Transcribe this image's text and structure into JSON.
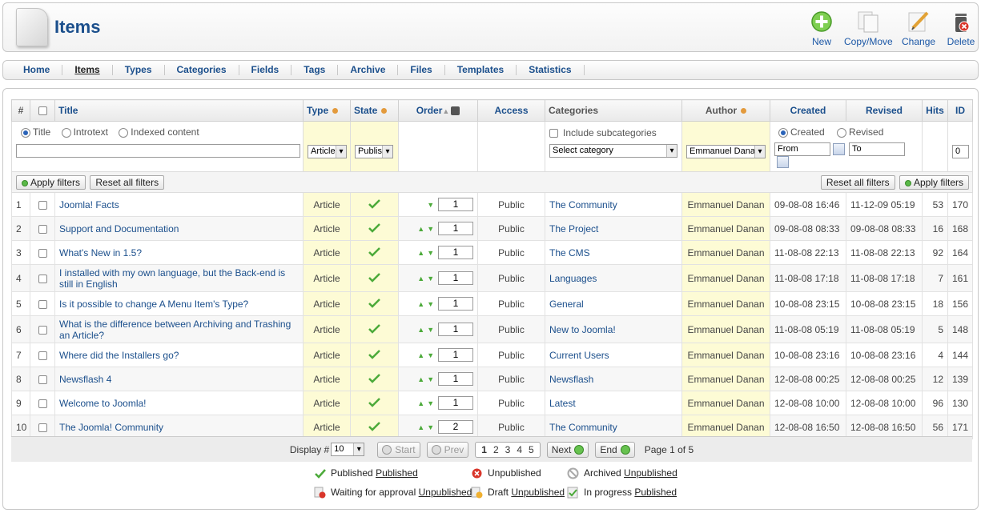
{
  "header": {
    "title": "Items"
  },
  "toolbar": [
    {
      "label": "New",
      "icon": "new-icon"
    },
    {
      "label": "Copy/Move",
      "icon": "copy-move-icon"
    },
    {
      "label": "Change",
      "icon": "change-icon"
    },
    {
      "label": "Delete",
      "icon": "delete-icon"
    }
  ],
  "menu": [
    "Home",
    "Items",
    "Types",
    "Categories",
    "Fields",
    "Tags",
    "Archive",
    "Files",
    "Templates",
    "Statistics"
  ],
  "menu_active": "Items",
  "columns": {
    "num": "#",
    "title": "Title",
    "type": "Type",
    "state": "State",
    "order": "Order",
    "access": "Access",
    "categories": "Categories",
    "author": "Author",
    "created": "Created",
    "revised": "Revised",
    "hits": "Hits",
    "id": "ID"
  },
  "filters": {
    "search_options": [
      "Title",
      "Introtext",
      "Indexed content"
    ],
    "search_selected": "Title",
    "search_value": "",
    "type_value": "Article",
    "state_value": "Publis",
    "include_subcategories": "Include subcategories",
    "category_value": "Select category",
    "author_value": "Emmanuel Dana",
    "date_options": [
      "Created",
      "Revised"
    ],
    "date_selected": "Created",
    "from_value": "From",
    "to_value": "To",
    "id_value": "0",
    "apply_label": "Apply filters",
    "reset_label": "Reset all filters"
  },
  "rows": [
    {
      "num": "1",
      "title": "Joomla! Facts",
      "type": "Article",
      "order": "1",
      "up": false,
      "access": "Public",
      "category": "The Community",
      "author": "Emmanuel Danan",
      "created": "09-08-08 16:46",
      "revised": "11-12-09 05:19",
      "hits": "53",
      "id": "170"
    },
    {
      "num": "2",
      "title": "Support and Documentation",
      "type": "Article",
      "order": "1",
      "up": true,
      "access": "Public",
      "category": "The Project",
      "author": "Emmanuel Danan",
      "created": "09-08-08 08:33",
      "revised": "09-08-08 08:33",
      "hits": "16",
      "id": "168"
    },
    {
      "num": "3",
      "title": "What's New in 1.5?",
      "type": "Article",
      "order": "1",
      "up": true,
      "access": "Public",
      "category": "The CMS",
      "author": "Emmanuel Danan",
      "created": "11-08-08 22:13",
      "revised": "11-08-08 22:13",
      "hits": "92",
      "id": "164"
    },
    {
      "num": "4",
      "title": "I installed with my own language, but the Back-end is still in English",
      "type": "Article",
      "order": "1",
      "up": true,
      "access": "Public",
      "category": "Languages",
      "author": "Emmanuel Danan",
      "created": "11-08-08 17:18",
      "revised": "11-08-08 17:18",
      "hits": "7",
      "id": "161"
    },
    {
      "num": "5",
      "title": "Is it possible to change A Menu Item's Type?",
      "type": "Article",
      "order": "1",
      "up": true,
      "access": "Public",
      "category": "General",
      "author": "Emmanuel Danan",
      "created": "10-08-08 23:15",
      "revised": "10-08-08 23:15",
      "hits": "18",
      "id": "156"
    },
    {
      "num": "6",
      "title": "What is the difference between Archiving and Trashing an Article?",
      "type": "Article",
      "order": "1",
      "up": true,
      "access": "Public",
      "category": "New to Joomla!",
      "author": "Emmanuel Danan",
      "created": "11-08-08 05:19",
      "revised": "11-08-08 05:19",
      "hits": "5",
      "id": "148"
    },
    {
      "num": "7",
      "title": "Where did the Installers go?",
      "type": "Article",
      "order": "1",
      "up": true,
      "access": "Public",
      "category": "Current Users",
      "author": "Emmanuel Danan",
      "created": "10-08-08 23:16",
      "revised": "10-08-08 23:16",
      "hits": "4",
      "id": "144"
    },
    {
      "num": "8",
      "title": "Newsflash 4",
      "type": "Article",
      "order": "1",
      "up": true,
      "access": "Public",
      "category": "Newsflash",
      "author": "Emmanuel Danan",
      "created": "12-08-08 00:25",
      "revised": "12-08-08 00:25",
      "hits": "12",
      "id": "139"
    },
    {
      "num": "9",
      "title": "Welcome to Joomla!",
      "type": "Article",
      "order": "1",
      "up": true,
      "access": "Public",
      "category": "Latest",
      "author": "Emmanuel Danan",
      "created": "12-08-08 10:00",
      "revised": "12-08-08 10:00",
      "hits": "96",
      "id": "130"
    },
    {
      "num": "10",
      "title": "The Joomla! Community",
      "type": "Article",
      "order": "2",
      "up": true,
      "access": "Public",
      "category": "The Community",
      "author": "Emmanuel Danan",
      "created": "12-08-08 16:50",
      "revised": "12-08-08 16:50",
      "hits": "56",
      "id": "171"
    }
  ],
  "pagination": {
    "display_label": "Display #",
    "display_value": "10",
    "start": "Start",
    "prev": "Prev",
    "pages": [
      "1",
      "2",
      "3",
      "4",
      "5"
    ],
    "current": "1",
    "next": "Next",
    "end": "End",
    "page_info": "Page 1 of 5"
  },
  "legend": {
    "published": {
      "text": "Published",
      "link": "Published"
    },
    "unpublished": {
      "text": "Unpublished"
    },
    "archived": {
      "text": "Archived",
      "link": "Unpublished"
    },
    "waiting": {
      "text": "Waiting for approval",
      "link": "Unpublished"
    },
    "draft": {
      "text": "Draft",
      "link": "Unpublished"
    },
    "inprogress": {
      "text": "In progress",
      "link": "Published"
    }
  },
  "colors": {
    "link": "#1b4f8c",
    "published": "#4caa3a",
    "highlight": "#fdfbd5"
  }
}
